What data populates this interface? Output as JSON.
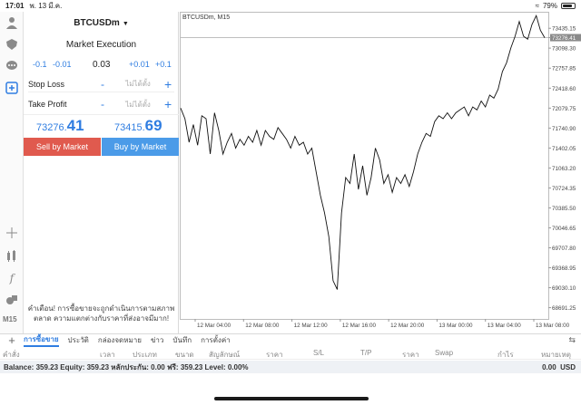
{
  "status": {
    "time": "17:01",
    "date": "พ. 13 มี.ค.",
    "battery": "79%"
  },
  "left_toolbar": {
    "timeframe": "M15",
    "icons": [
      "user-icon",
      "shield-icon",
      "chat-icon",
      "new-order-icon",
      "crosshair-icon",
      "indicators-icon",
      "function-icon",
      "objects-icon"
    ]
  },
  "order": {
    "symbol": "BTCUSDm",
    "execution": "Market Execution",
    "volume_steps": {
      "m01": "-0.1",
      "m001": "-0.01",
      "value": "0.03",
      "p001": "+0.01",
      "p01": "+0.1"
    },
    "stop_loss": {
      "label": "Stop Loss",
      "minus": "-",
      "value": "ไม่ได้ตั้ง",
      "plus": "+"
    },
    "take_profit": {
      "label": "Take Profit",
      "minus": "-",
      "value": "ไม่ได้ตั้ง",
      "plus": "+"
    },
    "bid": {
      "main": "73276.",
      "big": "41"
    },
    "ask": {
      "main": "73415.",
      "big": "69"
    },
    "sell_label": "Sell by Market",
    "buy_label": "Buy by Market",
    "warning": "คำเตือน! การซื้อขายจะถูกดำเนินการตามสภาพตลาด ความแตกต่างกับราคาที่ส่งอาจมีมาก!"
  },
  "chart_data": {
    "type": "line",
    "title": "BTCUSDm, M15",
    "current_price": "73276.41",
    "y_ticks": [
      "73435.15",
      "73276.41",
      "73098.30",
      "72757.85",
      "72418.60",
      "72079.75",
      "71740.90",
      "71402.05",
      "71063.20",
      "70724.35",
      "70385.50",
      "70046.65",
      "69707.80",
      "69368.95",
      "69030.10",
      "68691.25"
    ],
    "x_ticks": [
      "12 Mar 04:00",
      "12 Mar 08:00",
      "12 Mar 12:00",
      "12 Mar 16:00",
      "12 Mar 20:00",
      "13 Mar 00:00",
      "13 Mar 04:00",
      "13 Mar 08:00"
    ],
    "ylim": [
      68500,
      73700
    ],
    "series": [
      {
        "values": [
          72080,
          71900,
          71500,
          71800,
          71450,
          71950,
          71900,
          71300,
          72000,
          71700,
          71300,
          71500,
          71650,
          71400,
          71550,
          71450,
          71600,
          71500,
          71700,
          71450,
          71700,
          71600,
          71550,
          71750,
          71650,
          71550,
          71400,
          71600,
          71450,
          71500,
          71300,
          71400,
          71000,
          70600,
          70300,
          69900,
          69150,
          69000,
          70300,
          70900,
          70800,
          71300,
          70700,
          71100,
          70600,
          70900,
          71400,
          71200,
          70800,
          70950,
          70650,
          70900,
          70800,
          70950,
          70750,
          71000,
          71300,
          71500,
          71650,
          71600,
          71850,
          71950,
          71900,
          72000,
          71900,
          72000,
          72050,
          72100,
          71950,
          72100,
          72050,
          72200,
          72100,
          72300,
          72250,
          72400,
          72700,
          72850,
          73100,
          73300,
          73550,
          73300,
          73250,
          73500,
          73650,
          73400,
          73276
        ]
      }
    ]
  },
  "bottom": {
    "tabs": [
      "การซื้อขาย",
      "ประวัติ",
      "กล่องจดหมาย",
      "ข่าว",
      "บันทึก",
      "การตั้งค่า"
    ],
    "columns": [
      "คำสั่ง",
      "เวลา",
      "ประเภท",
      "ขนาด",
      "สัญลักษณ์",
      "ราคา",
      "S/L",
      "T/P",
      "ราคา",
      "Swap",
      "กำไร",
      "หมายเหตุ"
    ],
    "balance_text": "Balance: 359.23 Equity: 359.23 หลักประกัน: 0.00 ฟรี: 359.23 Level: 0.00%",
    "profit": "0.00",
    "currency": "USD"
  }
}
